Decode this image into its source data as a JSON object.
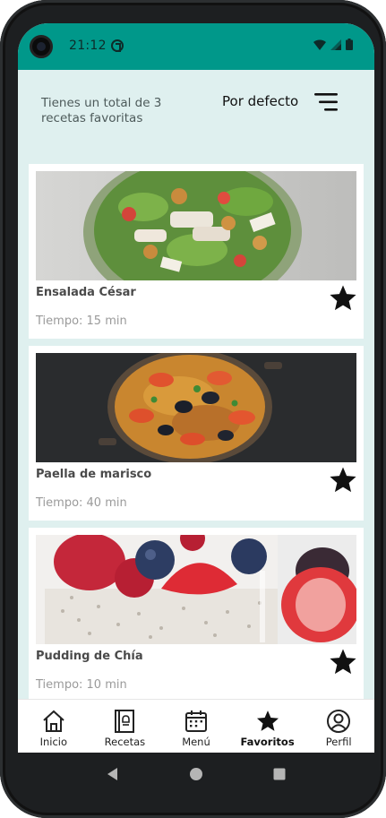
{
  "status_bar": {
    "time": "21:12"
  },
  "header": {
    "total_text": "Tienes un total de 3 recetas favoritas",
    "sort_label": "Por defecto"
  },
  "recipes": [
    {
      "title": "Ensalada César",
      "time": "Tiempo: 15 min",
      "favorite": true
    },
    {
      "title": "Paella de marisco",
      "time": "Tiempo: 40 min",
      "favorite": true
    },
    {
      "title": "Pudding de Chía",
      "time": "Tiempo: 10 min",
      "favorite": true
    }
  ],
  "bottom_nav": {
    "items": [
      {
        "label": "Inicio",
        "icon": "home-icon"
      },
      {
        "label": "Recetas",
        "icon": "recipe-book-icon"
      },
      {
        "label": "Menú",
        "icon": "calendar-icon"
      },
      {
        "label": "Favoritos",
        "icon": "star-icon",
        "active": true
      },
      {
        "label": "Perfil",
        "icon": "profile-icon"
      }
    ]
  },
  "colors": {
    "status_bar": "#00988a",
    "background": "#dff0ef",
    "star": "#111111"
  }
}
